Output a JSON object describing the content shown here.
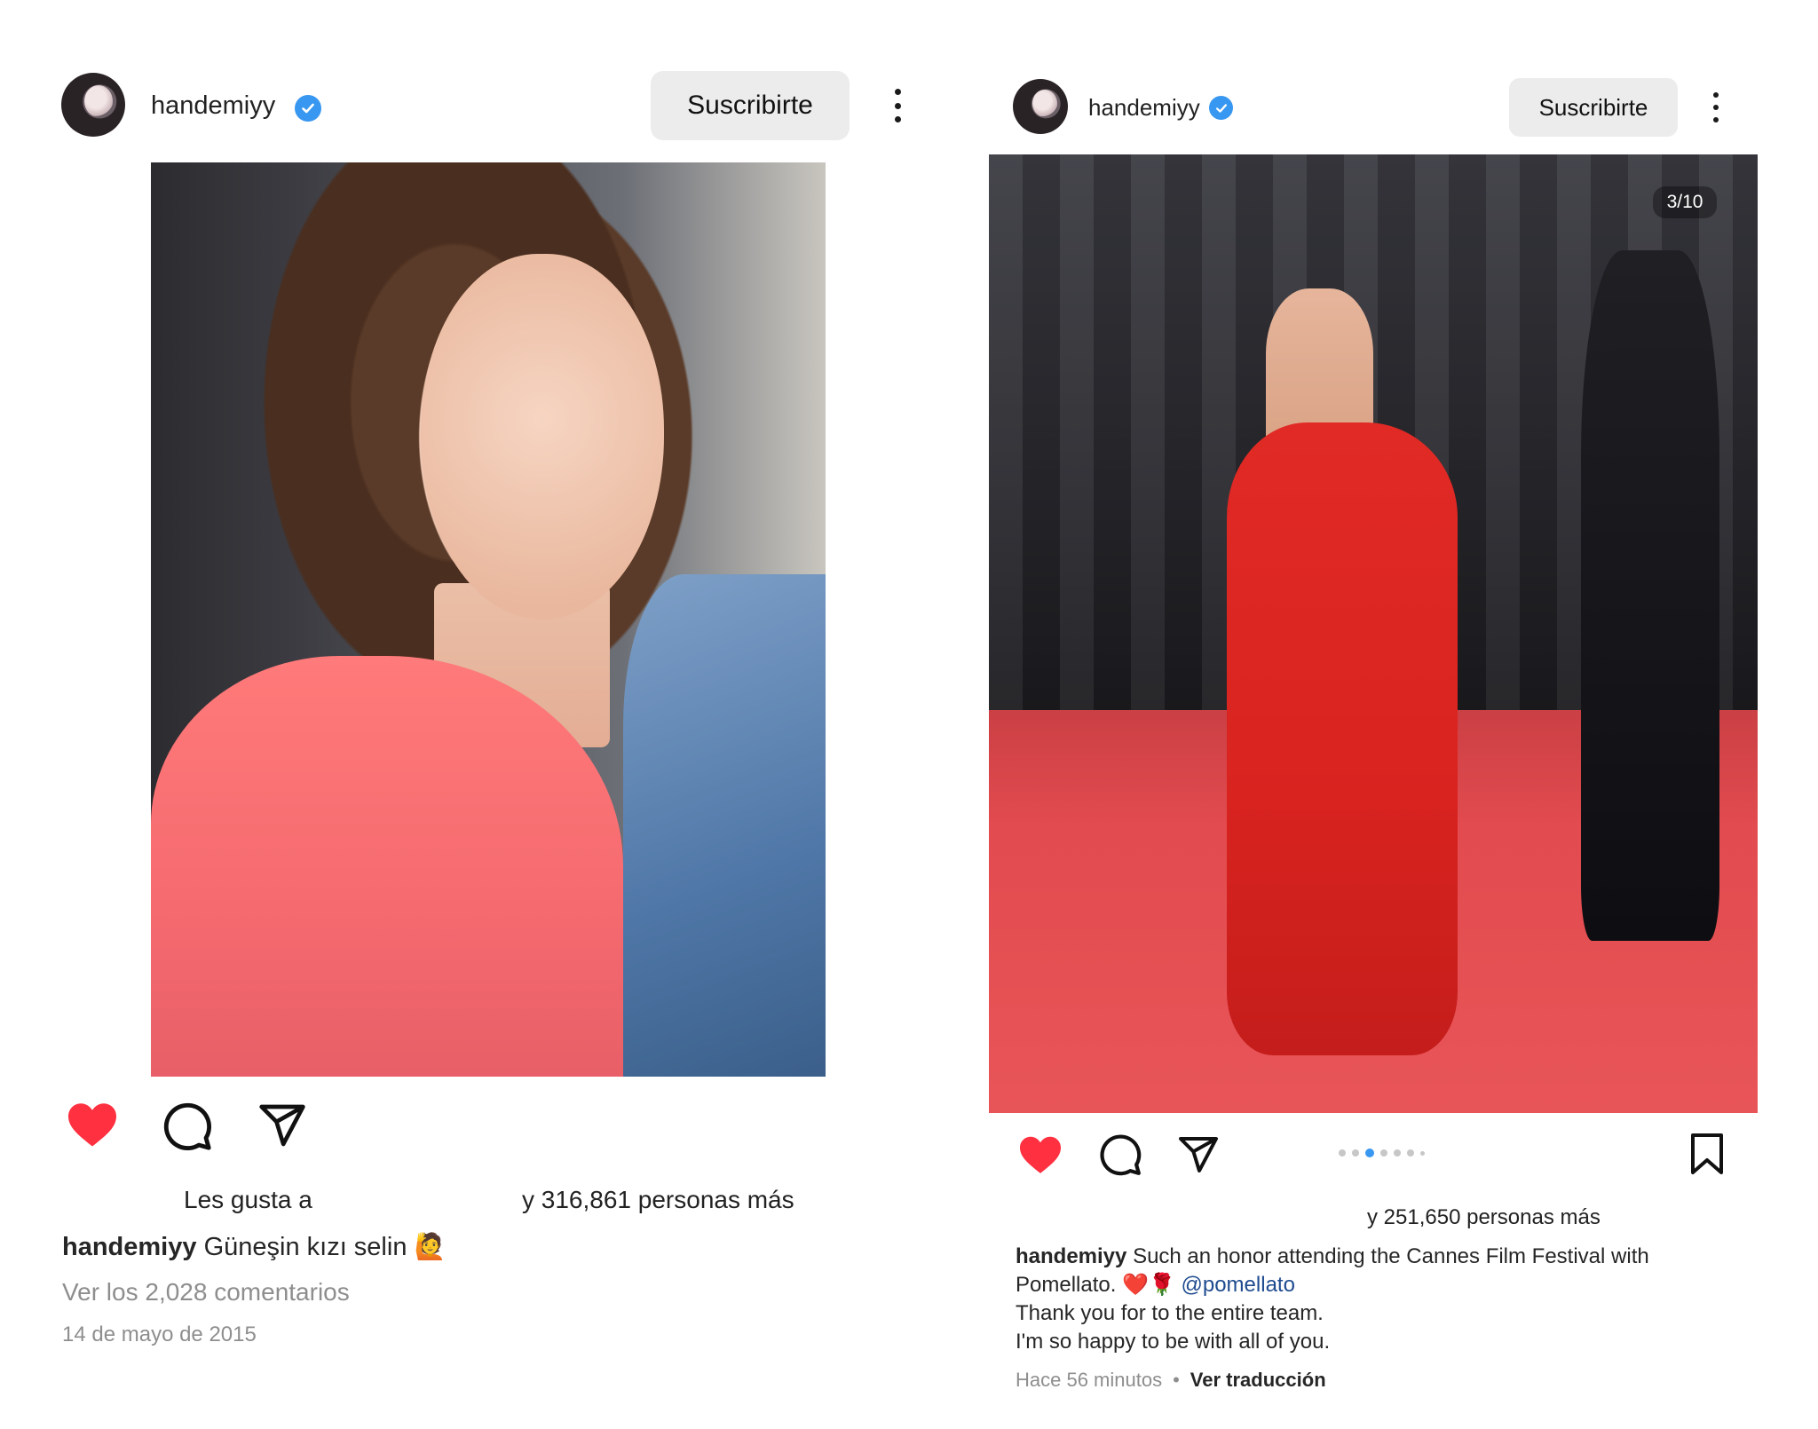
{
  "left_post": {
    "username": "handemiyy",
    "subscribe_label": "Suscribirte",
    "likes_label": "Les gusta a",
    "likes_count_text": "y 316,861 personas más",
    "caption_user": "handemiyy",
    "caption_text": "Güneşin kızı selin 🙋",
    "comments_link": "Ver los 2,028 comentarios",
    "date": "14 de mayo de 2015"
  },
  "right_post": {
    "username": "handemiyy",
    "subscribe_label": "Suscribirte",
    "photo_counter": "3/10",
    "carousel_total": 7,
    "carousel_active_index": 3,
    "likes_count_text": "y 251,650 personas más",
    "caption_user": "handemiyy",
    "caption_line1": "Such an honor attending the Cannes Film Festival with",
    "caption_line2_prefix": "Pomellato. ❤️🌹",
    "caption_mention": "@pomellato",
    "caption_line3": "Thank you for to the entire team.",
    "caption_line4": "I'm so happy to be with all of you.",
    "time_ago": "Hace 56 minutos",
    "separator": "•",
    "translate_label": "Ver traducción"
  },
  "icons": {
    "verified": "verified-badge-icon",
    "more": "more-options-icon",
    "like": "heart-icon",
    "comment": "comment-icon",
    "share": "share-icon",
    "save": "bookmark-icon"
  },
  "colors": {
    "like_red": "#ff3040",
    "verified_blue": "#3897f0",
    "subscribe_bg": "#ececec",
    "mention_blue": "#1e4b8f",
    "muted_gray": "#8e8e8e",
    "carousel_active": "#3897f0"
  }
}
